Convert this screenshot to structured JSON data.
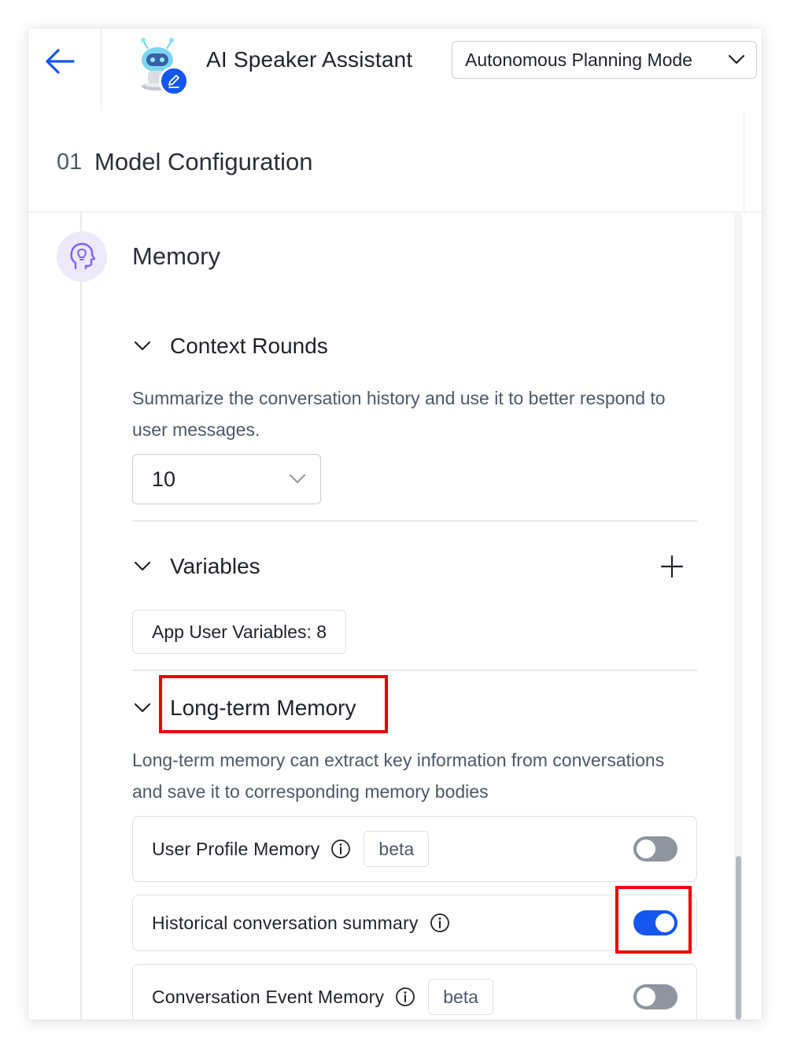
{
  "header": {
    "title": "AI Speaker Assistant",
    "mode_select": "Autonomous Planning Mode",
    "icons": [
      "back-arrow-icon",
      "robot-avatar-icon",
      "edit-pencil-icon",
      "chevron-down-icon"
    ]
  },
  "section": {
    "number": "01",
    "title": "Model Configuration"
  },
  "memory": {
    "title": "Memory",
    "icon": "head-idea-icon",
    "context_rounds": {
      "title": "Context Rounds",
      "description": "Summarize the conversation history and use it to better respond to user messages.",
      "selected_value": "10"
    },
    "variables": {
      "title": "Variables",
      "tag": "App User Variables: 8",
      "add_icon": "plus-icon"
    },
    "long_term": {
      "title": "Long-term Memory",
      "description": "Long-term memory can extract key information from conversations and save it to corresponding memory bodies",
      "items": [
        {
          "name": "User Profile Memory",
          "badge": "beta",
          "enabled": false
        },
        {
          "name": "Historical conversation summary",
          "badge": "",
          "enabled": true
        },
        {
          "name": "Conversation Event Memory",
          "badge": "beta",
          "enabled": false
        }
      ]
    }
  },
  "colors": {
    "accent": "#1456f0",
    "highlight": "#e8000b",
    "toggle_off": "#8f959e",
    "memory_icon_bg": "#ece9fb",
    "memory_icon": "#7b61ff"
  }
}
